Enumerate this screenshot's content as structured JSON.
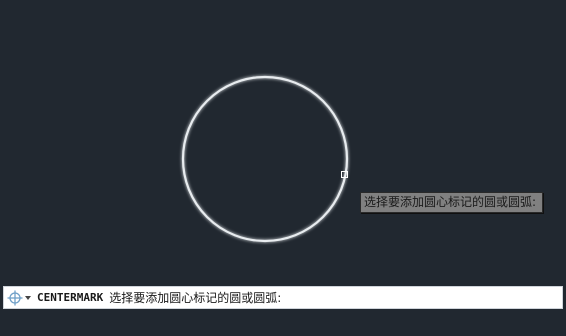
{
  "viewport": {
    "background": "#212830",
    "object": {
      "type": "circle",
      "stroke_color": "#e8ecef"
    },
    "tooltip": {
      "text": "选择要添加圆心标记的圆或圆弧:"
    }
  },
  "command_line": {
    "icon": "command-crosshair-icon",
    "command": "CENTERMARK",
    "prompt": "选择要添加圆心标记的圆或圆弧:"
  }
}
